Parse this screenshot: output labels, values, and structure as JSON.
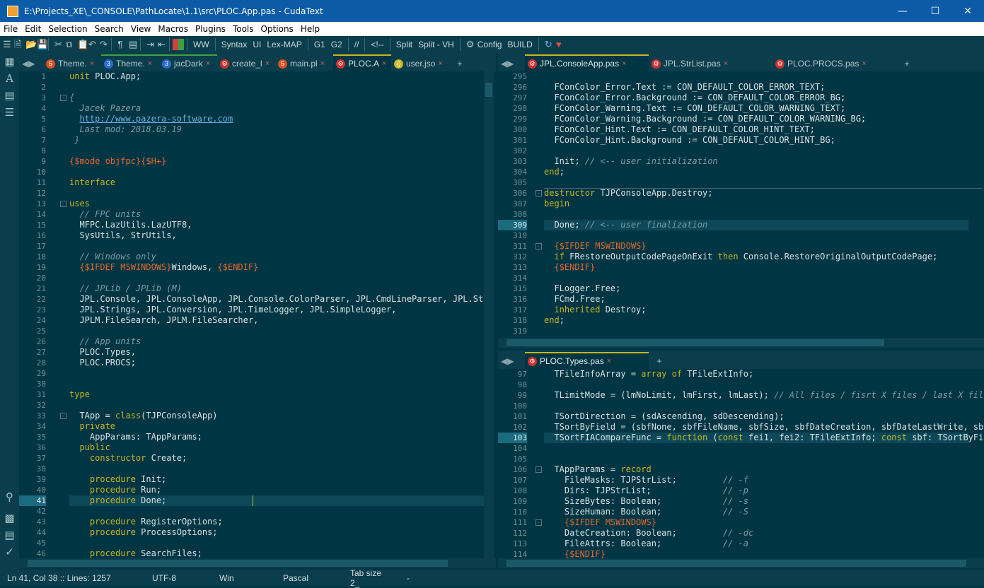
{
  "title": "E:\\Projects_XE\\_CONSOLE\\PathLocate\\1.1\\src\\PLOC.App.pas - CudaText",
  "menu": [
    "File",
    "Edit",
    "Selection",
    "Search",
    "View",
    "Macros",
    "Plugins",
    "Tools",
    "Options",
    "Help"
  ],
  "toolbar": {
    "ww": "WW",
    "syntax": "Syntax",
    "ui": "UI",
    "lexmap": "Lex-MAP",
    "g1": "G1",
    "g2": "G2",
    "comment": "//",
    "html_comment": "<!--",
    "split": "Split",
    "split_vh": "Split - VH",
    "config": "Config",
    "build": "BUILD"
  },
  "left_tabs": [
    {
      "label": "Theme.",
      "icon": "5",
      "color": "#e04e20"
    },
    {
      "label": "Theme.",
      "icon": "3",
      "color": "#2a6ad0"
    },
    {
      "label": "jacDark",
      "icon": "3",
      "color": "#2a6ad0"
    },
    {
      "label": "create_l",
      "icon": "gear",
      "color": "#d03030"
    },
    {
      "label": "main.pl",
      "icon": "5",
      "color": "#e04e20"
    },
    {
      "label": "PLOC.A",
      "icon": "gear",
      "color": "#d03030"
    },
    {
      "label": "user.jso",
      "icon": "{}",
      "color": "#c8b420"
    }
  ],
  "right_top_tabs": [
    {
      "label": "JPL.ConsoleApp.pas"
    },
    {
      "label": "JPL.StrList.pas"
    },
    {
      "label": "PLOC.PROCS.pas"
    }
  ],
  "right_bottom_tabs": [
    {
      "label": "PLOC.Types.pas"
    }
  ],
  "status": {
    "position": "Ln 41, Col 38 :: Lines: 1257",
    "encoding": "UTF-8",
    "line_ending": "Win",
    "lexer": "Pascal",
    "tab_size": "Tab size 2_",
    "extra": "-"
  },
  "left_lines": [
    {
      "n": "1",
      "t": [
        [
          "kw",
          "unit"
        ],
        [
          "fn",
          " PLOC.App;"
        ]
      ]
    },
    {
      "n": "2",
      "t": []
    },
    {
      "n": "3",
      "t": [
        [
          "cm",
          "{"
        ]
      ]
    },
    {
      "n": "4",
      "t": [
        [
          "cm",
          "  Jacek Pazera"
        ]
      ]
    },
    {
      "n": "5",
      "t": [
        [
          "fn",
          "  "
        ],
        [
          "ur",
          "http://www.pazera-software.com"
        ]
      ]
    },
    {
      "n": "6",
      "t": [
        [
          "cm",
          "  Last mod: 2018.03.19"
        ]
      ]
    },
    {
      "n": "7",
      "t": [
        [
          "cm",
          " }"
        ]
      ]
    },
    {
      "n": "8",
      "t": []
    },
    {
      "n": "9",
      "t": [
        [
          "dr",
          "{$mode objfpc}{$H+}"
        ]
      ]
    },
    {
      "n": "10",
      "t": []
    },
    {
      "n": "11",
      "t": [
        [
          "kw",
          "interface"
        ]
      ]
    },
    {
      "n": "12",
      "t": []
    },
    {
      "n": "13",
      "t": [
        [
          "kw",
          "uses"
        ]
      ]
    },
    {
      "n": "14",
      "t": [
        [
          "cm",
          "  // FPC units"
        ]
      ]
    },
    {
      "n": "15",
      "t": [
        [
          "fn",
          "  MFPC.LazUtils.LazUTF8,"
        ]
      ]
    },
    {
      "n": "16",
      "t": [
        [
          "fn",
          "  SysUtils, StrUtils,"
        ]
      ]
    },
    {
      "n": "17",
      "t": []
    },
    {
      "n": "18",
      "t": [
        [
          "cm",
          "  // Windows only"
        ]
      ]
    },
    {
      "n": "19",
      "t": [
        [
          "fn",
          "  "
        ],
        [
          "dr",
          "{$IFDEF MSWINDOWS}"
        ],
        [
          "fn",
          "Windows, "
        ],
        [
          "dr",
          "{$ENDIF}"
        ]
      ]
    },
    {
      "n": "20",
      "t": []
    },
    {
      "n": "21",
      "t": [
        [
          "cm",
          "  // JPLib / JPLib (M)"
        ]
      ]
    },
    {
      "n": "22",
      "t": [
        [
          "fn",
          "  JPL.Console, JPL.ConsoleApp, JPL.Console.ColorParser, JPL.CmdLineParser, JPL.StrL"
        ]
      ]
    },
    {
      "n": "23",
      "t": [
        [
          "fn",
          "  JPL.Strings, JPL.Conversion, JPL.TimeLogger, JPL.SimpleLogger,"
        ]
      ]
    },
    {
      "n": "24",
      "t": [
        [
          "fn",
          "  JPLM.FileSearch, JPLM.FileSearcher,"
        ]
      ]
    },
    {
      "n": "25",
      "t": []
    },
    {
      "n": "26",
      "t": [
        [
          "cm",
          "  // App units"
        ]
      ]
    },
    {
      "n": "27",
      "t": [
        [
          "fn",
          "  PLOC.Types,"
        ]
      ]
    },
    {
      "n": "28",
      "t": [
        [
          "fn",
          "  PLOC.PROCS;"
        ]
      ]
    },
    {
      "n": "29",
      "t": []
    },
    {
      "n": "30",
      "t": []
    },
    {
      "n": "31",
      "t": [
        [
          "kw",
          "type"
        ]
      ]
    },
    {
      "n": "32",
      "t": []
    },
    {
      "n": "33",
      "t": [
        [
          "fn",
          "  TApp = "
        ],
        [
          "kw",
          "class"
        ],
        [
          "fn",
          "(TJPConsoleApp)"
        ]
      ]
    },
    {
      "n": "34",
      "t": [
        [
          "kw",
          "  private"
        ]
      ]
    },
    {
      "n": "35",
      "t": [
        [
          "fn",
          "    AppParams: TAppParams;"
        ]
      ]
    },
    {
      "n": "36",
      "t": [
        [
          "kw",
          "  public"
        ]
      ]
    },
    {
      "n": "37",
      "t": [
        [
          "kw",
          "    constructor"
        ],
        [
          "fn",
          " Create;"
        ]
      ]
    },
    {
      "n": "38",
      "t": []
    },
    {
      "n": "39",
      "t": [
        [
          "kw",
          "    procedure"
        ],
        [
          "fn",
          " Init;"
        ]
      ]
    },
    {
      "n": "40",
      "t": [
        [
          "kw",
          "    procedure"
        ],
        [
          "fn",
          " Run;"
        ]
      ]
    },
    {
      "n": "41",
      "t": [
        [
          "kw",
          "    procedure"
        ],
        [
          "fn",
          " Done;"
        ]
      ]
    },
    {
      "n": "42",
      "t": []
    },
    {
      "n": "43",
      "t": [
        [
          "kw",
          "    procedure"
        ],
        [
          "fn",
          " RegisterOptions;"
        ]
      ]
    },
    {
      "n": "44",
      "t": [
        [
          "kw",
          "    procedure"
        ],
        [
          "fn",
          " ProcessOptions;"
        ]
      ]
    },
    {
      "n": "45",
      "t": []
    },
    {
      "n": "46",
      "t": [
        [
          "kw",
          "    procedure"
        ],
        [
          "fn",
          " SearchFiles;"
        ]
      ]
    }
  ],
  "right_top_lines": [
    {
      "n": "295",
      "t": []
    },
    {
      "n": "296",
      "t": [
        [
          "fn",
          "  FConColor_Error.Text := CON_DEFAULT_COLOR_ERROR_TEXT;"
        ]
      ]
    },
    {
      "n": "297",
      "t": [
        [
          "fn",
          "  FConColor_Error.Background := CON_DEFAULT_COLOR_ERROR_BG;"
        ]
      ]
    },
    {
      "n": "298",
      "t": [
        [
          "fn",
          "  FConColor_Warning.Text := CON_DEFAULT_COLOR_WARNING_TEXT;"
        ]
      ]
    },
    {
      "n": "299",
      "t": [
        [
          "fn",
          "  FConColor_Warning.Background := CON_DEFAULT_COLOR_WARNING_BG;"
        ]
      ]
    },
    {
      "n": "300",
      "t": [
        [
          "fn",
          "  FConColor_Hint.Text := CON_DEFAULT_COLOR_HINT_TEXT;"
        ]
      ]
    },
    {
      "n": "301",
      "t": [
        [
          "fn",
          "  FConColor_Hint.Background := CON_DEFAULT_COLOR_HINT_BG;"
        ]
      ]
    },
    {
      "n": "302",
      "t": []
    },
    {
      "n": "303",
      "t": [
        [
          "fn",
          "  Init; "
        ],
        [
          "cm",
          "// <-- user initialization"
        ]
      ]
    },
    {
      "n": "304",
      "t": [
        [
          "kw",
          "end"
        ],
        [
          "fn",
          ";"
        ]
      ]
    },
    {
      "n": "305",
      "t": []
    },
    {
      "n": "306",
      "t": [
        [
          "kw",
          "destructor"
        ],
        [
          "fn",
          " TJPConsoleApp.Destroy;"
        ]
      ]
    },
    {
      "n": "307",
      "t": [
        [
          "kw",
          "begin"
        ]
      ]
    },
    {
      "n": "308",
      "t": []
    },
    {
      "n": "309",
      "t": [
        [
          "fn",
          "  Done; "
        ],
        [
          "cm",
          "// <-- user finalization"
        ]
      ]
    },
    {
      "n": "310",
      "t": []
    },
    {
      "n": "311",
      "t": [
        [
          "fn",
          "  "
        ],
        [
          "dr",
          "{$IFDEF MSWINDOWS}"
        ]
      ]
    },
    {
      "n": "312",
      "t": [
        [
          "kw",
          "  if"
        ],
        [
          "fn",
          " FRestoreOutputCodePageOnExit "
        ],
        [
          "kw",
          "then"
        ],
        [
          "fn",
          " Console.RestoreOriginalOutputCodePage;"
        ]
      ]
    },
    {
      "n": "313",
      "t": [
        [
          "fn",
          "  "
        ],
        [
          "dr",
          "{$ENDIF}"
        ]
      ]
    },
    {
      "n": "314",
      "t": []
    },
    {
      "n": "315",
      "t": [
        [
          "fn",
          "  FLogger.Free;"
        ]
      ]
    },
    {
      "n": "316",
      "t": [
        [
          "fn",
          "  FCmd.Free;"
        ]
      ]
    },
    {
      "n": "317",
      "t": [
        [
          "kw",
          "  inherited"
        ],
        [
          "fn",
          " Destroy;"
        ]
      ]
    },
    {
      "n": "318",
      "t": [
        [
          "kw",
          "end"
        ],
        [
          "fn",
          ";"
        ]
      ]
    },
    {
      "n": "319",
      "t": []
    }
  ],
  "right_bottom_lines": [
    {
      "n": "97",
      "t": [
        [
          "fn",
          "  TFileInfoArray = "
        ],
        [
          "kw",
          "array of"
        ],
        [
          "fn",
          " TFileExtInfo;"
        ]
      ]
    },
    {
      "n": "98",
      "t": []
    },
    {
      "n": "99",
      "t": [
        [
          "fn",
          "  TLimitMode = (lmNoLimit, lmFirst, lmLast); "
        ],
        [
          "cm",
          "// All files / fisrt X files / last X fil"
        ]
      ]
    },
    {
      "n": "100",
      "t": []
    },
    {
      "n": "101",
      "t": [
        [
          "fn",
          "  TSortDirection = (sdAscending, sdDescending);"
        ]
      ]
    },
    {
      "n": "102",
      "t": [
        [
          "fn",
          "  TSortByField = (sbfNone, sbfFileName, sbfSize, sbfDateCreation, sbfDateLastWrite, sb"
        ]
      ]
    },
    {
      "n": "103",
      "t": [
        [
          "fn",
          "  TSortFIACompareFunc = "
        ],
        [
          "kw",
          "function"
        ],
        [
          "fn",
          " ("
        ],
        [
          "kw",
          "const"
        ],
        [
          "fn",
          " fei1, fei2: TFileExtInfo; "
        ],
        [
          "kw",
          "const"
        ],
        [
          "fn",
          " sbf: TSortByFi"
        ]
      ]
    },
    {
      "n": "104",
      "t": []
    },
    {
      "n": "105",
      "t": []
    },
    {
      "n": "106",
      "t": [
        [
          "fn",
          "  TAppParams = "
        ],
        [
          "kw",
          "record"
        ]
      ]
    },
    {
      "n": "107",
      "t": [
        [
          "fn",
          "    FileMasks: TJPStrList;         "
        ],
        [
          "cm",
          "// -f"
        ]
      ]
    },
    {
      "n": "108",
      "t": [
        [
          "fn",
          "    Dirs: TJPStrList;              "
        ],
        [
          "cm",
          "// -p"
        ]
      ]
    },
    {
      "n": "109",
      "t": [
        [
          "fn",
          "    SizeBytes: Boolean;            "
        ],
        [
          "cm",
          "// -s"
        ]
      ]
    },
    {
      "n": "110",
      "t": [
        [
          "fn",
          "    SizeHuman: Boolean;            "
        ],
        [
          "cm",
          "// -S"
        ]
      ]
    },
    {
      "n": "111",
      "t": [
        [
          "fn",
          "    "
        ],
        [
          "dr",
          "{$IFDEF MSWINDOWS}"
        ]
      ]
    },
    {
      "n": "112",
      "t": [
        [
          "fn",
          "    DateCreation: Boolean;         "
        ],
        [
          "cm",
          "// -dc"
        ]
      ]
    },
    {
      "n": "113",
      "t": [
        [
          "fn",
          "    FileAttrs: Boolean;            "
        ],
        [
          "cm",
          "// -a"
        ]
      ]
    },
    {
      "n": "114",
      "t": [
        [
          "fn",
          "    "
        ],
        [
          "dr",
          "{$ENDIF}"
        ]
      ]
    }
  ]
}
